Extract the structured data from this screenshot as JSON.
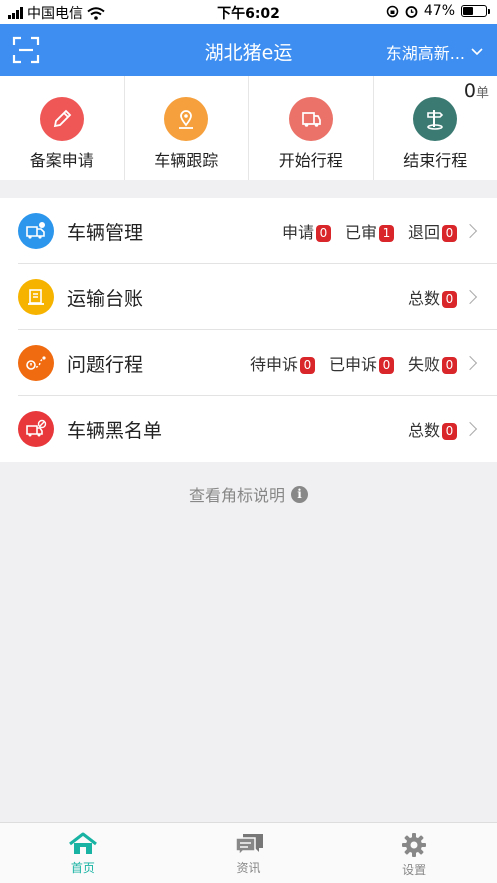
{
  "status_bar": {
    "carrier": "中国电信",
    "time": "下午6:02",
    "battery": "47%"
  },
  "header": {
    "title": "湖北猪e运",
    "location": "东湖高新..."
  },
  "quick_actions": [
    {
      "label": "备案申请",
      "color": "#ef5757",
      "icon": "edit-icon"
    },
    {
      "label": "车辆跟踪",
      "color": "#f5a03c",
      "icon": "location-pin-icon"
    },
    {
      "label": "开始行程",
      "color": "#ea7268",
      "icon": "truck-icon"
    },
    {
      "label": "结束行程",
      "color": "#3b7a72",
      "icon": "signpost-icon"
    }
  ],
  "order_count": {
    "value": "0",
    "unit": "单"
  },
  "menu": [
    {
      "title": "车辆管理",
      "color": "#2c96ec",
      "badges": [
        {
          "label": "申请",
          "count": "0"
        },
        {
          "label": "已审",
          "count": "1"
        },
        {
          "label": "退回",
          "count": "0"
        }
      ]
    },
    {
      "title": "运输台账",
      "color": "#f6b400",
      "badges": [
        {
          "label": "总数",
          "count": "0"
        }
      ]
    },
    {
      "title": "问题行程",
      "color": "#f06a10",
      "badges": [
        {
          "label": "待申诉",
          "count": "0"
        },
        {
          "label": "已申诉",
          "count": "0"
        },
        {
          "label": "失败",
          "count": "0"
        }
      ]
    },
    {
      "title": "车辆黑名单",
      "color": "#e8383c",
      "badges": [
        {
          "label": "总数",
          "count": "0"
        }
      ]
    }
  ],
  "help_text": "查看角标说明",
  "tabs": [
    {
      "label": "首页",
      "active": true
    },
    {
      "label": "资讯",
      "active": false
    },
    {
      "label": "设置",
      "active": false
    }
  ]
}
